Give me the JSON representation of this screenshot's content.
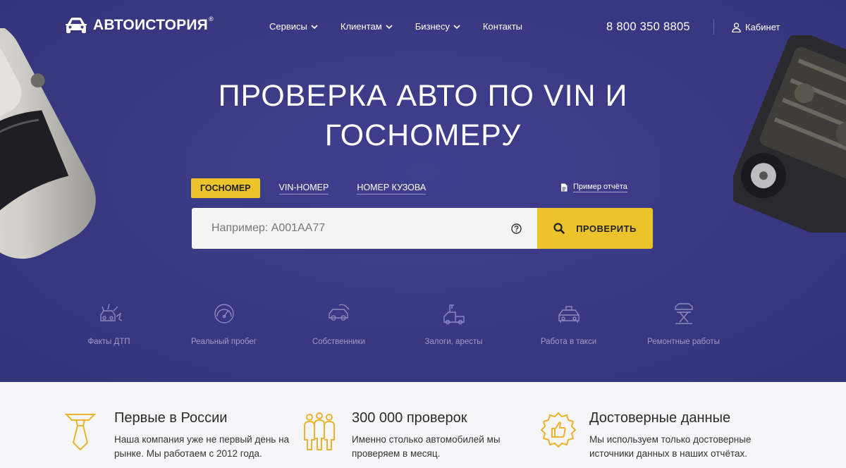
{
  "brand": {
    "name": "АВТОИСТОРИЯ",
    "reg": "®"
  },
  "nav": [
    {
      "label": "Сервисы"
    },
    {
      "label": "Клиентам"
    },
    {
      "label": "Бизнесу"
    },
    {
      "label": "Контакты"
    }
  ],
  "phone": "8 800 350 8805",
  "cabinet": "Кабинет",
  "hero": {
    "title_line1": "ПРОВЕРКА АВТО ПО VIN И",
    "title_line2": "ГОСНОМЕРУ"
  },
  "tabs": {
    "active": "ГОСНОМЕР",
    "vin": "VIN-НОМЕР",
    "body": "НОМЕР КУЗОВА"
  },
  "sample_report": "Пример отчёта",
  "search": {
    "placeholder": "Например: А001АА77",
    "button": "ПРОВЕРИТЬ"
  },
  "features": [
    {
      "label": "Факты ДТП",
      "icon": "crash-car-icon"
    },
    {
      "label": "Реальный пробег",
      "icon": "speedometer-icon"
    },
    {
      "label": "Собственники",
      "icon": "car-owner-icon"
    },
    {
      "label": "Залоги, аресты",
      "icon": "tow-truck-icon"
    },
    {
      "label": "Работа в такси",
      "icon": "taxi-icon"
    },
    {
      "label": "Ремонтные работы",
      "icon": "car-lift-icon"
    }
  ],
  "benefits": [
    {
      "title": "Первые в России",
      "text": "Наша компания уже не первый день на рынке. Мы работаем с 2012 года.",
      "icon": "tie-icon"
    },
    {
      "title": "300 000 проверок",
      "text": "Именно столько автомобилей мы проверяем в месяц.",
      "icon": "people-icon"
    },
    {
      "title": "Достоверные данные",
      "text": "Мы используем только достоверные источники данных в наших отчётах.",
      "icon": "thumbs-up-badge-icon"
    }
  ],
  "colors": {
    "hero_bg": "#3a3a85",
    "accent": "#ecc32b",
    "feature_icon": "#8a8ac0"
  }
}
